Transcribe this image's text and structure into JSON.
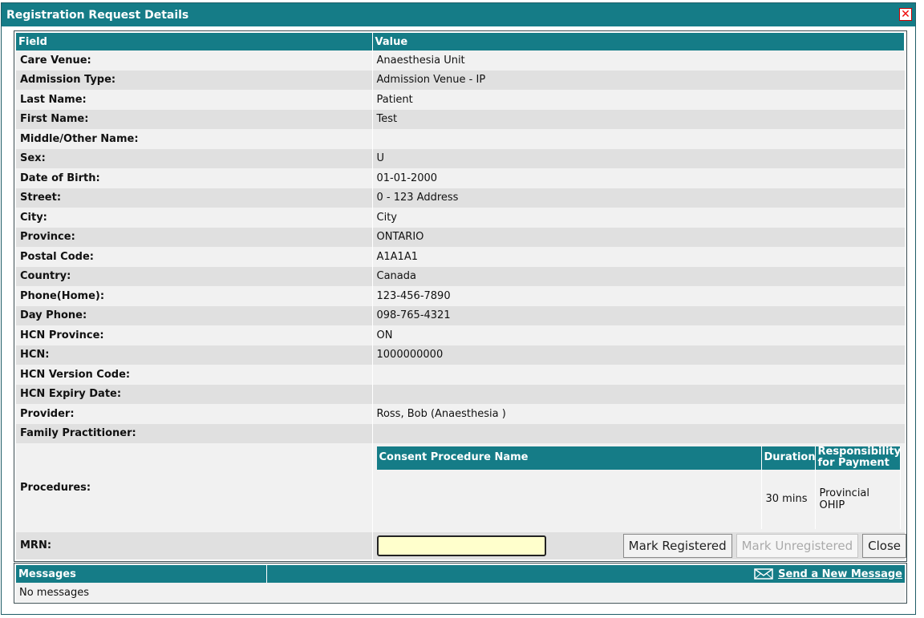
{
  "dialog": {
    "title": "Registration Request Details",
    "close_icon": "close-icon"
  },
  "table": {
    "headers": {
      "field": "Field",
      "value": "Value"
    },
    "rows": [
      {
        "field": "Care Venue:",
        "value": "Anaesthesia Unit"
      },
      {
        "field": "Admission Type:",
        "value": "Admission Venue - IP"
      },
      {
        "field": "Last Name:",
        "value": "Patient"
      },
      {
        "field": "First Name:",
        "value": "Test"
      },
      {
        "field": "Middle/Other Name:",
        "value": ""
      },
      {
        "field": "Sex:",
        "value": "U"
      },
      {
        "field": "Date of Birth:",
        "value": "01-01-2000"
      },
      {
        "field": "Street:",
        "value": "0 - 123 Address"
      },
      {
        "field": "City:",
        "value": "City"
      },
      {
        "field": "Province:",
        "value": "ONTARIO"
      },
      {
        "field": "Postal Code:",
        "value": "A1A1A1"
      },
      {
        "field": "Country:",
        "value": "Canada"
      },
      {
        "field": "Phone(Home):",
        "value": "123-456-7890"
      },
      {
        "field": "Day Phone:",
        "value": "098-765-4321"
      },
      {
        "field": "HCN Province:",
        "value": "ON"
      },
      {
        "field": "HCN:",
        "value": "1000000000"
      },
      {
        "field": "HCN Version Code:",
        "value": ""
      },
      {
        "field": "HCN Expiry Date:",
        "value": ""
      },
      {
        "field": "Provider:",
        "value": "Ross, Bob (Anaesthesia )"
      },
      {
        "field": "Family Practitioner:",
        "value": ""
      }
    ],
    "procedures": {
      "label": "Procedures:",
      "headers": {
        "name": "Consent Procedure Name",
        "duration": "Duration",
        "responsibility": "Responsibility for Payment"
      },
      "rows": [
        {
          "name": "",
          "duration": "30 mins",
          "responsibility": "Provincial OHIP"
        }
      ]
    },
    "mrn": {
      "label": "MRN:",
      "value": ""
    }
  },
  "buttons": {
    "mark_registered": "Mark Registered",
    "mark_unregistered": "Mark Unregistered",
    "close": "Close"
  },
  "messages": {
    "title": "Messages",
    "send_link": "Send a New Message",
    "envelope_icon": "envelope-icon",
    "empty_text": "No messages"
  },
  "colors": {
    "header_teal": "#157c87",
    "row_light": "#f1f1f1",
    "row_dark": "#e0e0e0",
    "mrn_bg": "#ffffcc"
  }
}
